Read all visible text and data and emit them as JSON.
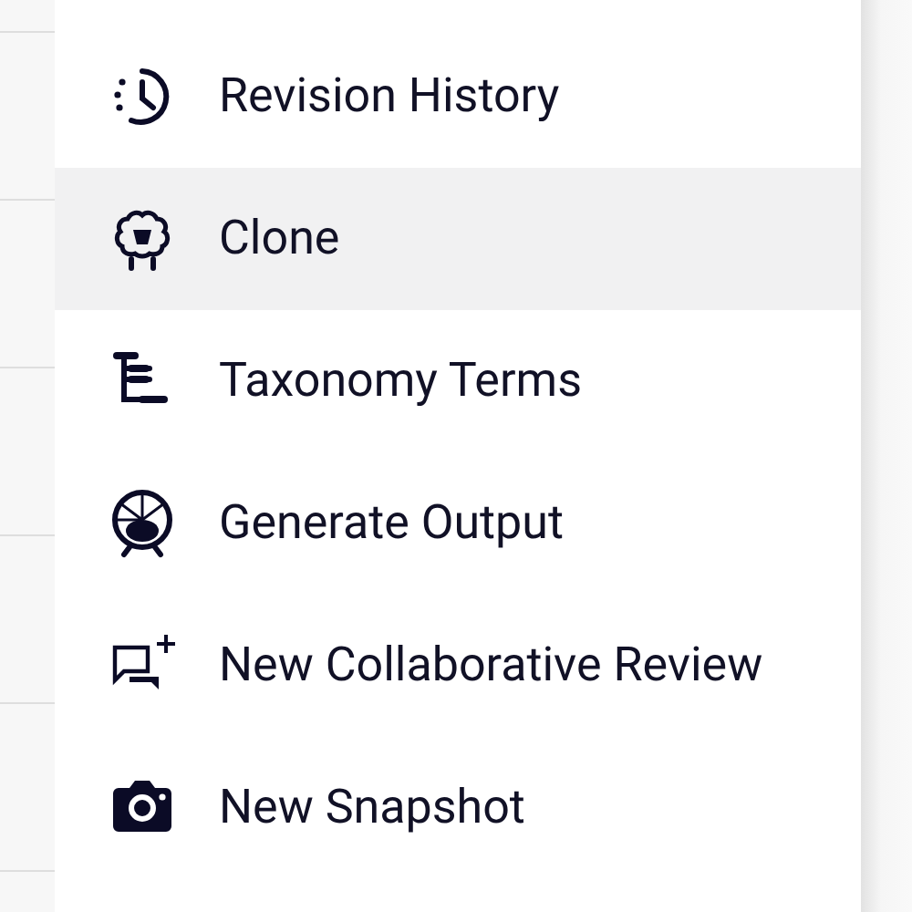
{
  "menu": {
    "items": [
      {
        "label": "Revision History",
        "selected": false
      },
      {
        "label": "Clone",
        "selected": true
      },
      {
        "label": "Taxonomy Terms",
        "selected": false
      },
      {
        "label": "Generate Output",
        "selected": false
      },
      {
        "label": "New Collaborative Review",
        "selected": false
      },
      {
        "label": "New Snapshot",
        "selected": false
      }
    ]
  }
}
